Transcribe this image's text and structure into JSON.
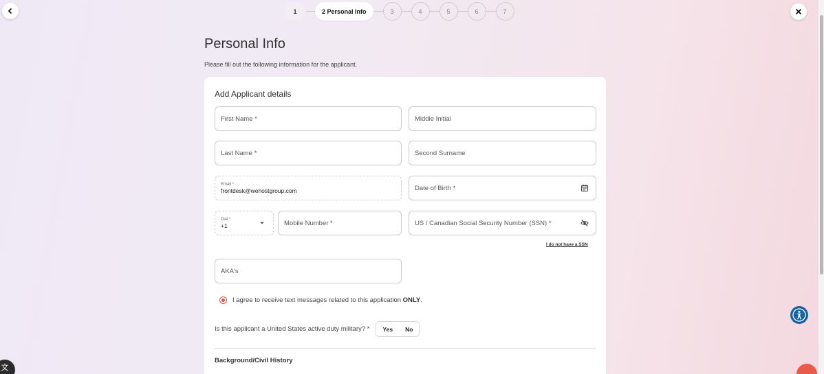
{
  "nav": {
    "back_icon": "chevron-left-icon",
    "close_icon": "close-icon"
  },
  "stepper": {
    "steps": [
      {
        "label": "1",
        "state": "done"
      },
      {
        "label": "2 Personal Info",
        "state": "active"
      },
      {
        "label": "3",
        "state": "future"
      },
      {
        "label": "4",
        "state": "future"
      },
      {
        "label": "5",
        "state": "future"
      },
      {
        "label": "6",
        "state": "future"
      },
      {
        "label": "7",
        "state": "future"
      }
    ]
  },
  "page": {
    "title": "Personal Info",
    "subtitle": "Please fill out the following information for the applicant."
  },
  "form": {
    "card_title": "Add Applicant details",
    "first_name": "First Name *",
    "middle_initial": "Middle Initial",
    "last_name": "Last Name *",
    "second_surname": "Second Surname",
    "email_label": "Email *",
    "email_value": "frontdesk@wehostgroup.com",
    "dob": "Date of Birth *",
    "dial_label": "Dial *",
    "dial_value": "+1",
    "mobile": "Mobile Number *",
    "ssn": "US / Canadian Social Security Number (SSN) *",
    "no_ssn_link": "I do not have a SSN",
    "aka": "AKA's",
    "consent_text": "I agree to receive text messages related to this application",
    "consent_emphasis": "ONLY",
    "consent_end": ".",
    "military_question": "Is this applicant a United States active duty military? *",
    "yes": "Yes",
    "no": "No",
    "section_title": "Background/Civil History"
  },
  "colors": {
    "accent": "#e9533a",
    "a11y": "#1464a5"
  }
}
